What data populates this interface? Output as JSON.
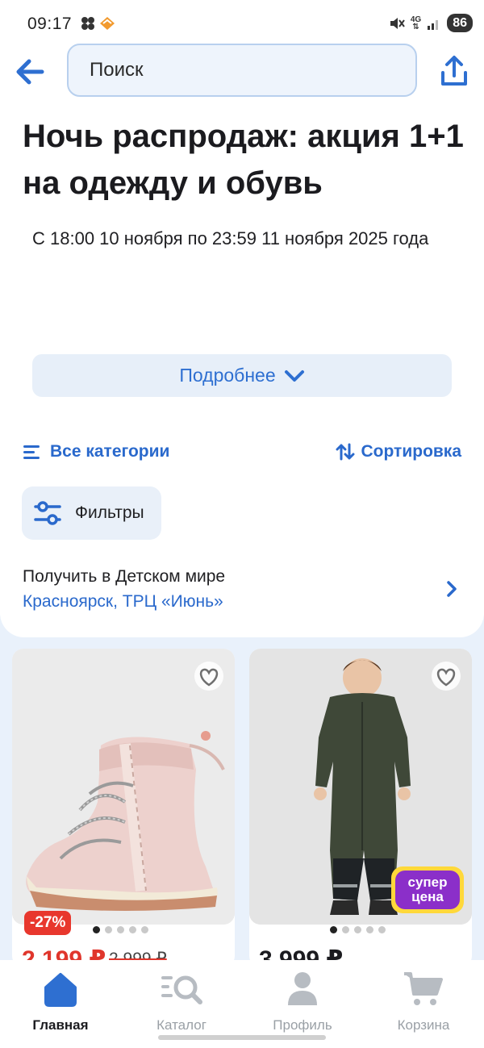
{
  "status_bar": {
    "time": "09:17",
    "network": "4G",
    "battery": "86"
  },
  "header": {
    "search_placeholder": "Поиск",
    "back_icon": "arrow-left-icon",
    "share_icon": "share-icon"
  },
  "promo": {
    "title": "Ночь распродаж: акция 1+1 на одежду и обувь",
    "dates": "С 18:00 10 ноября по 23:59 11 ноября 2025 года",
    "more_label": "Подробнее"
  },
  "toolbar": {
    "categories_label": "Все категории",
    "sort_label": "Сортировка",
    "filters_label": "Фильтры"
  },
  "pickup": {
    "label": "Получить в Детском мире",
    "place": "Красноярск, ТРЦ «Июнь»"
  },
  "products": [
    {
      "discount": "-27%",
      "price": "2 199 ₽",
      "old_price": "2 999 ₽",
      "image": "pink-winter-boot",
      "dots_total": 5,
      "dots_active": 0
    },
    {
      "price": "3 999 ₽",
      "badge": "супер цена",
      "badge_line1": "супер",
      "badge_line2": "цена",
      "image": "child-dark-green-snowsuit",
      "dots_total": 5,
      "dots_active": 0
    }
  ],
  "bottom_nav": [
    {
      "label": "Главная",
      "icon": "home-icon",
      "active": true
    },
    {
      "label": "Каталог",
      "icon": "catalog-search-icon",
      "active": false
    },
    {
      "label": "Профиль",
      "icon": "profile-icon",
      "active": false
    },
    {
      "label": "Корзина",
      "icon": "cart-icon",
      "active": false
    }
  ],
  "colors": {
    "accent": "#2a69cc",
    "sale": "#e0362c",
    "page_bg": "#e9f1fb"
  }
}
